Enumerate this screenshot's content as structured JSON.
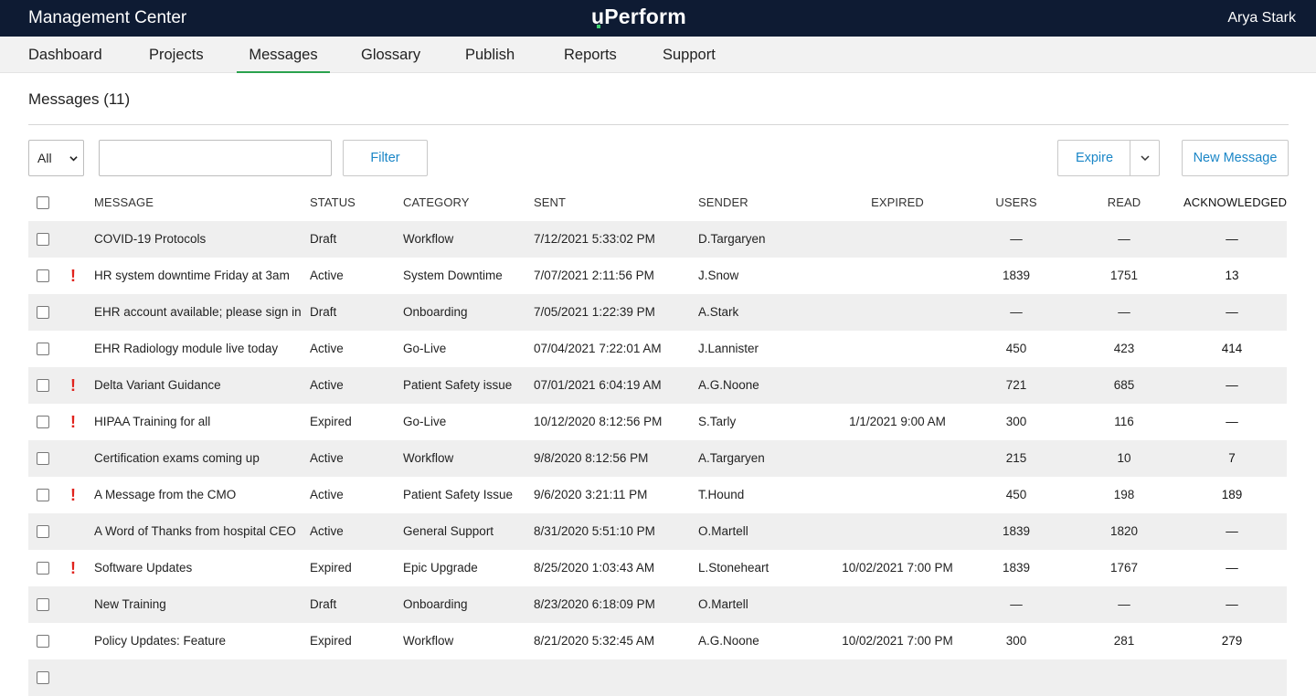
{
  "app": {
    "title": "Management Center",
    "brand": "uPerform",
    "user": "Arya Stark",
    "accent_color": "#2aa24e",
    "link_color": "#1a86c7",
    "header_bg": "#0e1b33"
  },
  "nav": {
    "tabs": [
      {
        "label": "Dashboard",
        "active": false
      },
      {
        "label": "Projects",
        "active": false
      },
      {
        "label": "Messages",
        "active": true
      },
      {
        "label": "Glossary",
        "active": false
      },
      {
        "label": "Publish",
        "active": false
      },
      {
        "label": "Reports",
        "active": false
      },
      {
        "label": "Support",
        "active": false
      }
    ]
  },
  "page": {
    "heading": "Messages (11)"
  },
  "toolbar": {
    "status_select": "All",
    "search_value": "",
    "search_placeholder": "",
    "filter_label": "Filter",
    "expire_label": "Expire",
    "new_message_label": "New Message"
  },
  "table": {
    "headers": {
      "message": "MESSAGE",
      "status": "STATUS",
      "category": "CATEGORY",
      "sent": "SENT",
      "sender": "SENDER",
      "expired": "EXPIRED",
      "users": "USERS",
      "read": "READ",
      "acknowledged": "ACKNOWLEDGED"
    },
    "rows": [
      {
        "urgent": false,
        "message": "COVID-19 Protocols",
        "status": "Draft",
        "category": "Workflow",
        "sent": "7/12/2021 5:33:02 PM",
        "sender": "D.Targaryen",
        "expired": "",
        "users": "—",
        "read": "—",
        "acknowledged": "—"
      },
      {
        "urgent": true,
        "message": "HR system downtime Friday at 3am",
        "status": "Active",
        "category": "System Downtime",
        "sent": "7/07/2021 2:11:56 PM",
        "sender": "J.Snow",
        "expired": "",
        "users": "1839",
        "read": "1751",
        "acknowledged": "13"
      },
      {
        "urgent": false,
        "message": "EHR account available; please sign in",
        "status": "Draft",
        "category": "Onboarding",
        "sent": "7/05/2021 1:22:39 PM",
        "sender": "A.Stark",
        "expired": "",
        "users": "—",
        "read": "—",
        "acknowledged": "—"
      },
      {
        "urgent": false,
        "message": "EHR Radiology module live today",
        "status": "Active",
        "category": "Go-Live",
        "sent": "07/04/2021 7:22:01 AM",
        "sender": "J.Lannister",
        "expired": "",
        "users": "450",
        "read": "423",
        "acknowledged": "414"
      },
      {
        "urgent": true,
        "message": "Delta Variant Guidance",
        "status": "Active",
        "category": "Patient Safety issue",
        "sent": "07/01/2021 6:04:19 AM",
        "sender": "A.G.Noone",
        "expired": "",
        "users": "721",
        "read": "685",
        "acknowledged": "—"
      },
      {
        "urgent": true,
        "message": "HIPAA Training for all",
        "status": "Expired",
        "category": "Go-Live",
        "sent": "10/12/2020 8:12:56 PM",
        "sender": "S.Tarly",
        "expired": "1/1/2021 9:00 AM",
        "users": "300",
        "read": "116",
        "acknowledged": "—"
      },
      {
        "urgent": false,
        "message": "Certification exams coming up",
        "status": "Active",
        "category": "Workflow",
        "sent": "9/8/2020 8:12:56 PM",
        "sender": "A.Targaryen",
        "expired": "",
        "users": "215",
        "read": "10",
        "acknowledged": "7"
      },
      {
        "urgent": true,
        "message": "A Message from the CMO",
        "status": "Active",
        "category": "Patient Safety Issue",
        "sent": "9/6/2020 3:21:11 PM",
        "sender": "T.Hound",
        "expired": "",
        "users": "450",
        "read": "198",
        "acknowledged": "189"
      },
      {
        "urgent": false,
        "message": "A Word of Thanks from hospital CEO",
        "status": "Active",
        "category": "General Support",
        "sent": "8/31/2020 5:51:10 PM",
        "sender": "O.Martell",
        "expired": "",
        "users": "1839",
        "read": "1820",
        "acknowledged": "—"
      },
      {
        "urgent": true,
        "message": "Software Updates",
        "status": "Expired",
        "category": "Epic Upgrade",
        "sent": "8/25/2020 1:03:43 AM",
        "sender": "L.Stoneheart",
        "expired": "10/02/2021 7:00 PM",
        "users": "1839",
        "read": "1767",
        "acknowledged": "—"
      },
      {
        "urgent": false,
        "message": "New Training",
        "status": "Draft",
        "category": "Onboarding",
        "sent": "8/23/2020 6:18:09 PM",
        "sender": "O.Martell",
        "expired": "",
        "users": "—",
        "read": "—",
        "acknowledged": "—"
      },
      {
        "urgent": false,
        "message": "Policy Updates: Feature",
        "status": "Expired",
        "category": "Workflow",
        "sent": "8/21/2020 5:32:45 AM",
        "sender": "A.G.Noone",
        "expired": "10/02/2021 7:00 PM",
        "users": "300",
        "read": "281",
        "acknowledged": "279"
      },
      {
        "urgent": false,
        "message": "",
        "status": "",
        "category": "",
        "sent": "",
        "sender": "",
        "expired": "",
        "users": "",
        "read": "",
        "acknowledged": ""
      }
    ]
  }
}
